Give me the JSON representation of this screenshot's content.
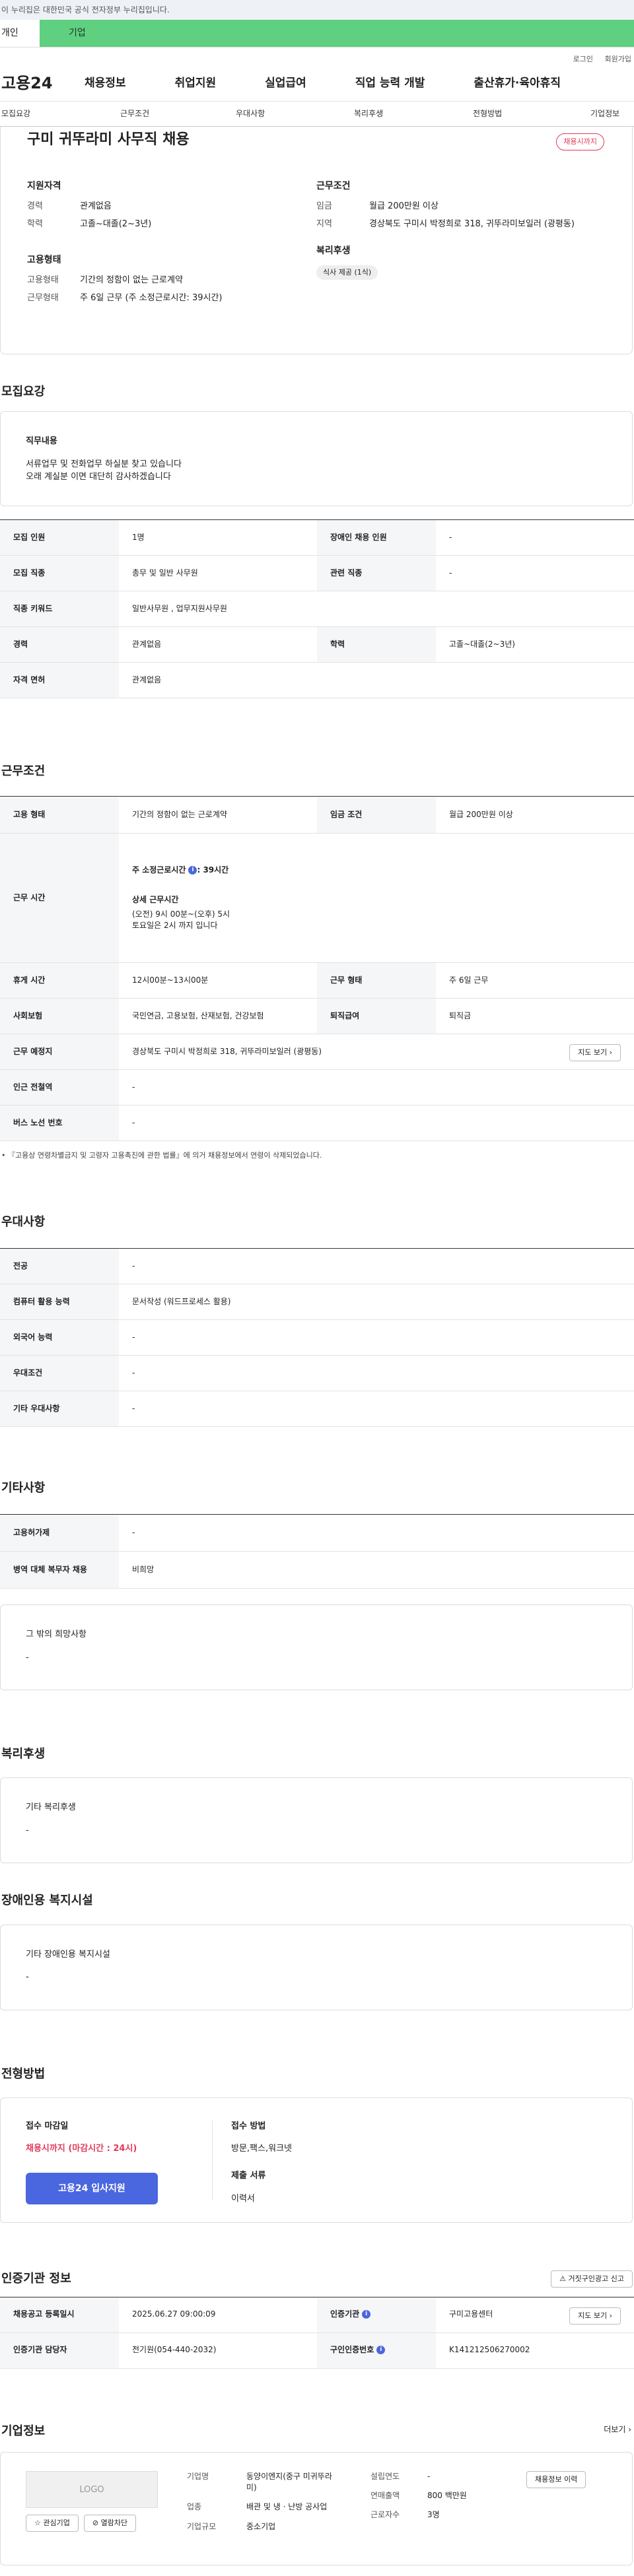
{
  "gov_notice": "이 누리집은 대한민국 공식 전자정부 누리집입니다.",
  "user_tabs": [
    "개인",
    "기업"
  ],
  "top_links": [
    "로그인",
    "회원가입"
  ],
  "site_logo": "고용24",
  "gnb": [
    "채용정보",
    "취업지원",
    "실업급여",
    "직업 능력 개발",
    "출산휴가·육아휴직"
  ],
  "subnav": [
    "모집요강",
    "근무조건",
    "우대사항",
    "복리후생",
    "전형방법",
    "기업정보"
  ],
  "summary": {
    "title": "구미 귀뚜라미 사무직 채용",
    "badge": "채용시까지",
    "qual_h": "지원자격",
    "qual": [
      {
        "k": "경력",
        "v": "관계없음"
      },
      {
        "k": "학력",
        "v": "고졸~대졸(2~3년)"
      }
    ],
    "emp_h": "고용형태",
    "emp": [
      {
        "k": "고용형태",
        "v": "기간의 정함이 없는 근로계약"
      },
      {
        "k": "근무형태",
        "v": "주 6일 근무 (주 소정근로시간: 39시간)"
      }
    ],
    "cond_h": "근무조건",
    "cond": [
      {
        "k": "임금",
        "v": "월급 200만원 이상"
      },
      {
        "k": "지역",
        "v": "경상북도 구미시 박정희로 318, 귀뚜라미보일러 (광평동)"
      }
    ],
    "welfare_h": "복리후생",
    "welfare_pill": "식사 제공 (1식)"
  },
  "recruit": {
    "title": "모집요강",
    "job_h": "직무내용",
    "job_lines": [
      "서류업무 및 전화업무 하실분 찾고 있습니다",
      "오래 계실분 이면 대단히 감사하겠습니다"
    ],
    "rows": {
      "count_k": "모집 인원",
      "count_v": "1명",
      "disabled_k": "장애인 채용 인원",
      "disabled_v": "-",
      "job_k": "모집 직종",
      "job_v": "총무 및 일반 사무원",
      "related_k": "관련 직종",
      "related_v": "-",
      "kw_k": "직종 키워드",
      "kw_v": "일반사무원 , 업무지원사무원",
      "career_k": "경력",
      "career_v": "관계없음",
      "edu_k": "학력",
      "edu_v": "고졸~대졸(2~3년)",
      "license_k": "자격 면허",
      "license_v": "관계없음"
    }
  },
  "work": {
    "title": "근무조건",
    "type_k": "고용 형태",
    "type_v": "기간의 정함이 없는 근로계약",
    "wage_k": "임금 조건",
    "wage_v": "월급 200만원 이상",
    "hours_k": "근무 시간",
    "hours_weekly": "주 소정근로시간",
    "hours_weekly_v": ": 39시간",
    "hours_detail_h": "상세 근무시간",
    "hours_detail": [
      "(오전) 9시 00분~(오후) 5시",
      "토요일은 2시 까지 입니다"
    ],
    "break_k": "휴게 시간",
    "break_v": "12시00분~13시00분",
    "shift_k": "근무 형태",
    "shift_v": "주 6일 근무",
    "ins_k": "사회보험",
    "ins_v": "국민연금, 고용보험, 산재보험, 건강보험",
    "ret_k": "퇴직급여",
    "ret_v": "퇴직금",
    "place_k": "근무 예정지",
    "place_v": "경상북도 구미시 박정희로 318, 귀뚜라미보일러 (광평동)",
    "map_btn": "지도 보기",
    "subway_k": "인근 전철역",
    "subway_v": "-",
    "bus_k": "버스 노선 번호",
    "bus_v": "-",
    "notice": "『고용상 연령차별금지 및 고령자 고용촉진에 관한 법률』에 의거 채용정보에서 연령이 삭제되었습니다."
  },
  "pref": {
    "title": "우대사항",
    "major_k": "전공",
    "major_v": "-",
    "pc_k": "컴퓨터 활용 능력",
    "pc_v": "문서작성 (워드프로세스 활용)",
    "lang_k": "외국어 능력",
    "lang_v": "-",
    "cond_k": "우대조건",
    "cond_v": "-",
    "etc_k": "기타 우대사항",
    "etc_v": "-"
  },
  "other": {
    "title": "기타사항",
    "permit_k": "고용허가제",
    "permit_v": "-",
    "mil_k": "병역 대체 복무자 채용",
    "mil_v": "비희망",
    "wish_h": "그 밖의 희망사항",
    "wish_v": "-"
  },
  "welfare": {
    "title": "복리후생",
    "h": "기타 복리후생",
    "v": "-"
  },
  "disab": {
    "title": "장애인용 복지시설",
    "h": "기타 장애인용 복지시설",
    "v": "-"
  },
  "process": {
    "title": "전형방법",
    "deadline_h": "접수 마감일",
    "deadline_v": "채용시까지 (마감시간 : 24시)",
    "apply_btn": "고용24 입사지원",
    "method_h": "접수 방법",
    "method_v": "방문,팩스,워크넷",
    "docs_h": "제출 서류",
    "docs_v": "이력서"
  },
  "agency": {
    "title": "인증기관 정보",
    "report_btn": "거짓구인광고 신고",
    "reg_k": "채용공고 등록일시",
    "reg_v": "2025.06.27 09:00:09",
    "org_k": "인증기관",
    "org_v": "구미고용센터",
    "map_btn": "지도 보기",
    "staff_k": "인증기관 담당자",
    "staff_v": "전기원(054-440-2032)",
    "num_k": "구인인증번호",
    "num_v": "K141212506270002"
  },
  "company": {
    "title": "기업정보",
    "more": "더보기",
    "logo": "LOGO",
    "fav_btn": "관심기업",
    "block_btn": "열람차단",
    "name_k": "기업명",
    "name_v": "동양이엔지(중구 미귀뚜라미)",
    "ind_k": "업종",
    "ind_v": "배관 및 냉 · 난방 공사업",
    "size_k": "기업규모",
    "size_v": "중소기업",
    "year_k": "설립연도",
    "year_v": "-",
    "sales_k": "연매출액",
    "sales_v": "800 백만원",
    "emp_k": "근로자수",
    "emp_v": "3명",
    "jobs_btn": "채용정보 이력"
  }
}
